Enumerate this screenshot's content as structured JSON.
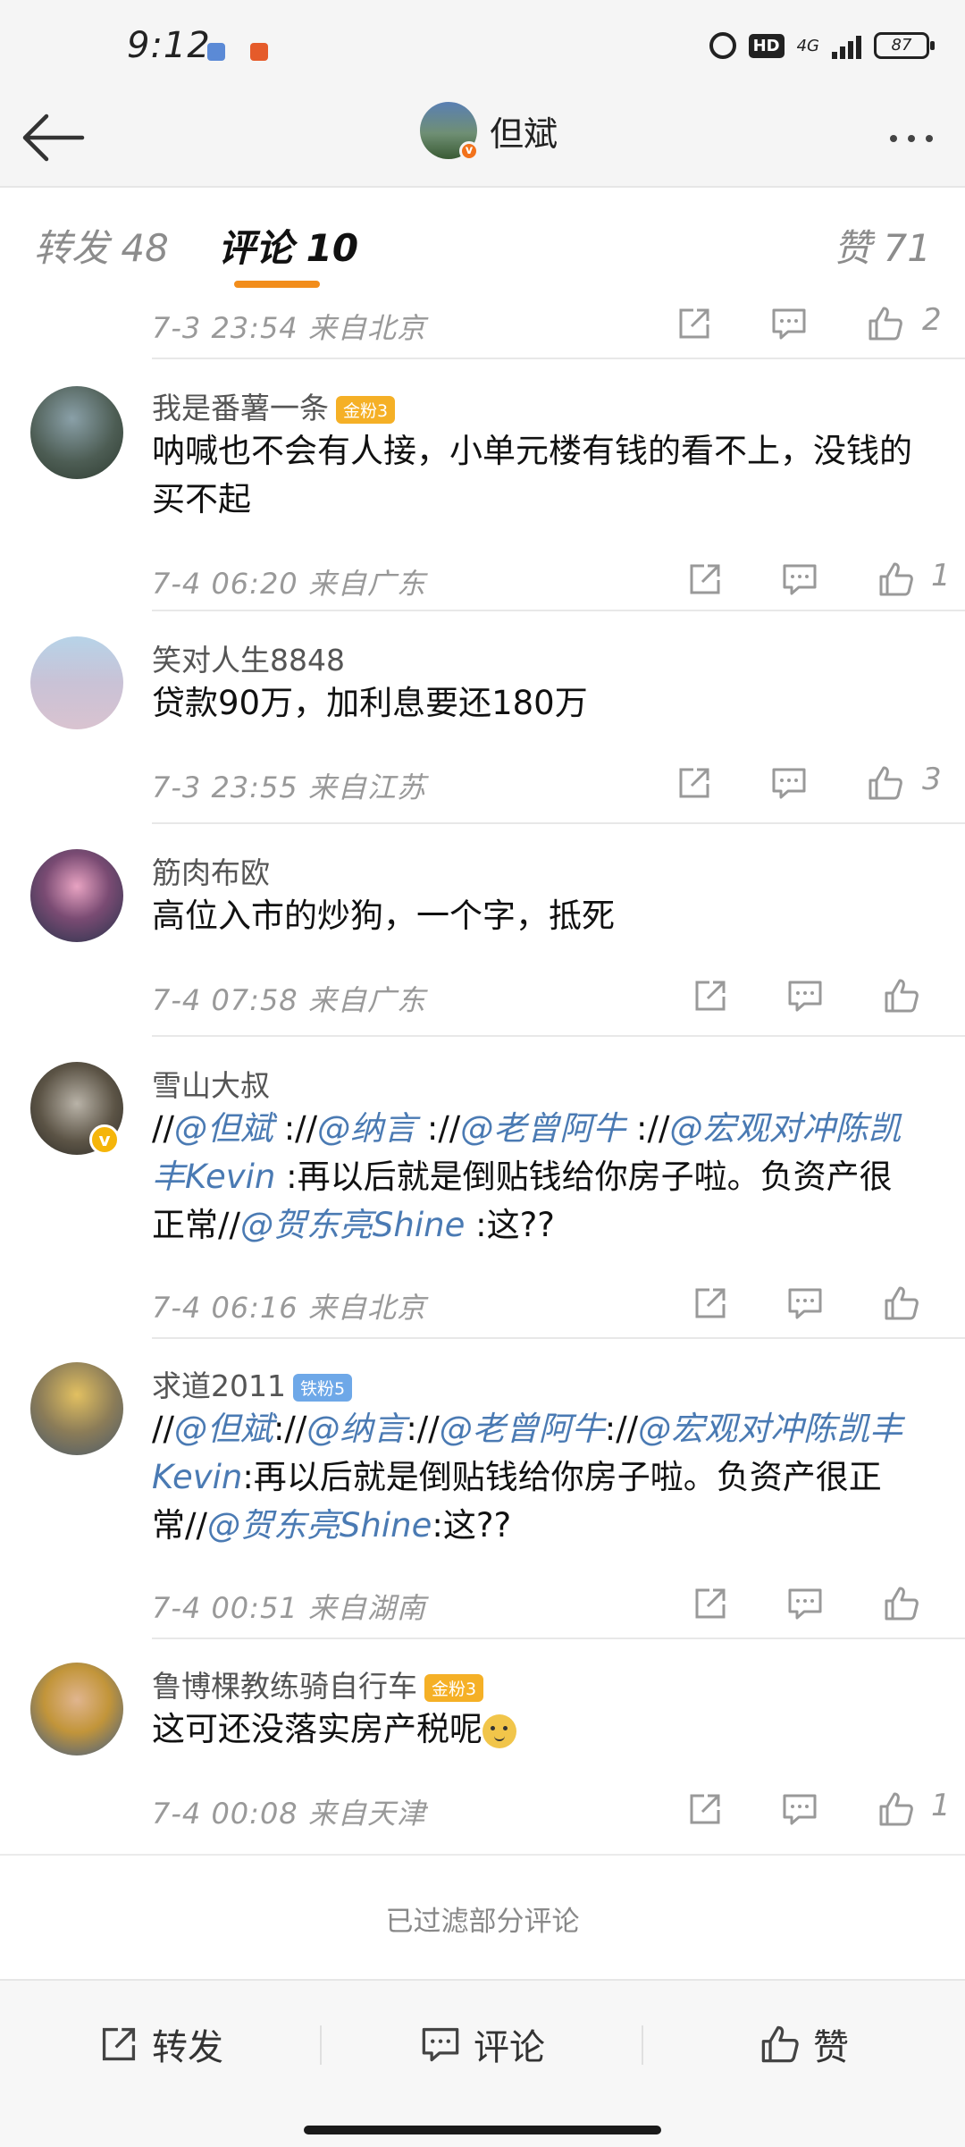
{
  "status_bar": {
    "time": "9:12",
    "network": "4G",
    "hd": "HD",
    "battery": "87"
  },
  "header": {
    "back_icon": "back-arrow-icon",
    "title": "但斌",
    "more_icon": "more-icon"
  },
  "tabs": {
    "repost": "转发  48",
    "comment": "评论  10",
    "like": "赞  71"
  },
  "top_partial": {
    "time": "7-3  23:54  来自北京",
    "likes": "2"
  },
  "comments": [
    {
      "name": "我是番薯一条",
      "badge": "金粉3",
      "text": "呐喊也不会有人接，小单元楼有钱的看不上，没钱的买不起",
      "time": "7-4  06:20  来自广东",
      "likes": "1"
    },
    {
      "name": "笑对人生8848",
      "text": "贷款90万，加利息要还180万",
      "time": "7-3  23:55  来自江苏",
      "likes": "3"
    },
    {
      "name": "筋肉布欧",
      "text": "高位入市的炒狗，一个字，抵死",
      "time": "7-4  07:58  来自广东",
      "likes": ""
    },
    {
      "name": "雪山大叔",
      "text_parts": {
        "p1": "//",
        "m1": "@但斌",
        "p2": "  ://",
        "m2": "@纳言",
        "p3": "  ://",
        "m3": "@老曾阿牛",
        "p4": "  ://",
        "m4": "@宏观对冲陈凯丰Kevin",
        "p5": "  :再以后就是倒贴钱给你房子啦。负资产很正常//",
        "m5": "@贺东亮Shine",
        "p6": "  :这??"
      },
      "time": "7-4  06:16  来自北京",
      "likes": ""
    },
    {
      "name": "求道2011",
      "badge": "铁粉5",
      "text_parts": {
        "p1": "//",
        "m1": "@但斌",
        "p2": "://",
        "m2": "@纳言",
        "p3": "://",
        "m3": "@老曾阿牛",
        "p4": "://",
        "m4": "@宏观对冲陈凯丰Kevin",
        "p5": ":再以后就是倒贴钱给你房子啦。负资产很正常//",
        "m5": "@贺东亮Shine",
        "p6": ":这??"
      },
      "time": "7-4  00:51  来自湖南",
      "likes": ""
    },
    {
      "name": "鲁博棵教练骑自行车",
      "badge": "金粉3",
      "text": "这可还没落实房产税呢",
      "emoji": "doge-emoji",
      "time": "7-4  00:08  来自天津",
      "likes": "1"
    }
  ],
  "filtered_note": "已过滤部分评论",
  "bottom_bar": {
    "repost": "转发",
    "comment": "评论",
    "like": "赞"
  },
  "colors": {
    "accent": "#f28d1b",
    "mention": "#4a7ab3",
    "meta": "#999999"
  }
}
